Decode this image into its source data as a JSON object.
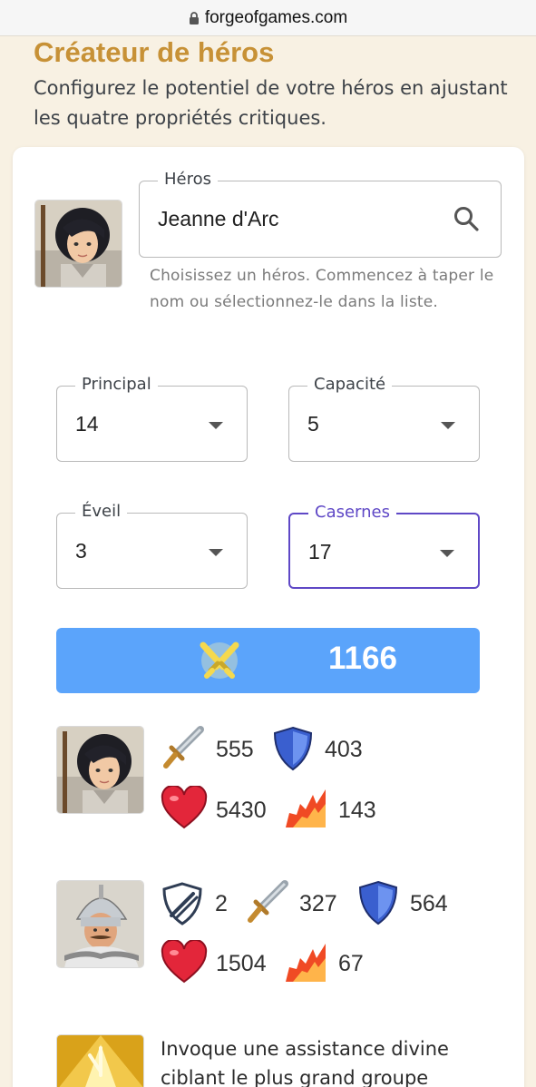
{
  "browser": {
    "url": "forgeofgames.com"
  },
  "header": {
    "title": "Créateur de héros",
    "description": "Configurez le potentiel de votre héros en ajustant les quatre propriétés critiques."
  },
  "hero_field": {
    "legend": "Héros",
    "value": "Jeanne d'Arc",
    "helper": "Choisissez un héros. Commencez à taper le nom ou sélectionnez-le dans la liste."
  },
  "selects": {
    "principal": {
      "label": "Principal",
      "value": "14"
    },
    "capacite": {
      "label": "Capacité",
      "value": "5"
    },
    "eveil": {
      "label": "Éveil",
      "value": "3"
    },
    "casernes": {
      "label": "Casernes",
      "value": "17"
    }
  },
  "power": {
    "value": "1166",
    "icon": "crossed-swords-icon"
  },
  "hero_stats": {
    "attack": "555",
    "defense": "403",
    "health": "5430",
    "speed": "143"
  },
  "unit_stats": {
    "armor": "2",
    "attack": "327",
    "defense": "564",
    "health": "1504",
    "speed": "67"
  },
  "skill": {
    "description": "Invoque une assistance divine ciblant le plus grand groupe"
  },
  "colors": {
    "accent": "#c79136",
    "focus": "#5f48c6",
    "power_bar": "#5ba4fb"
  }
}
